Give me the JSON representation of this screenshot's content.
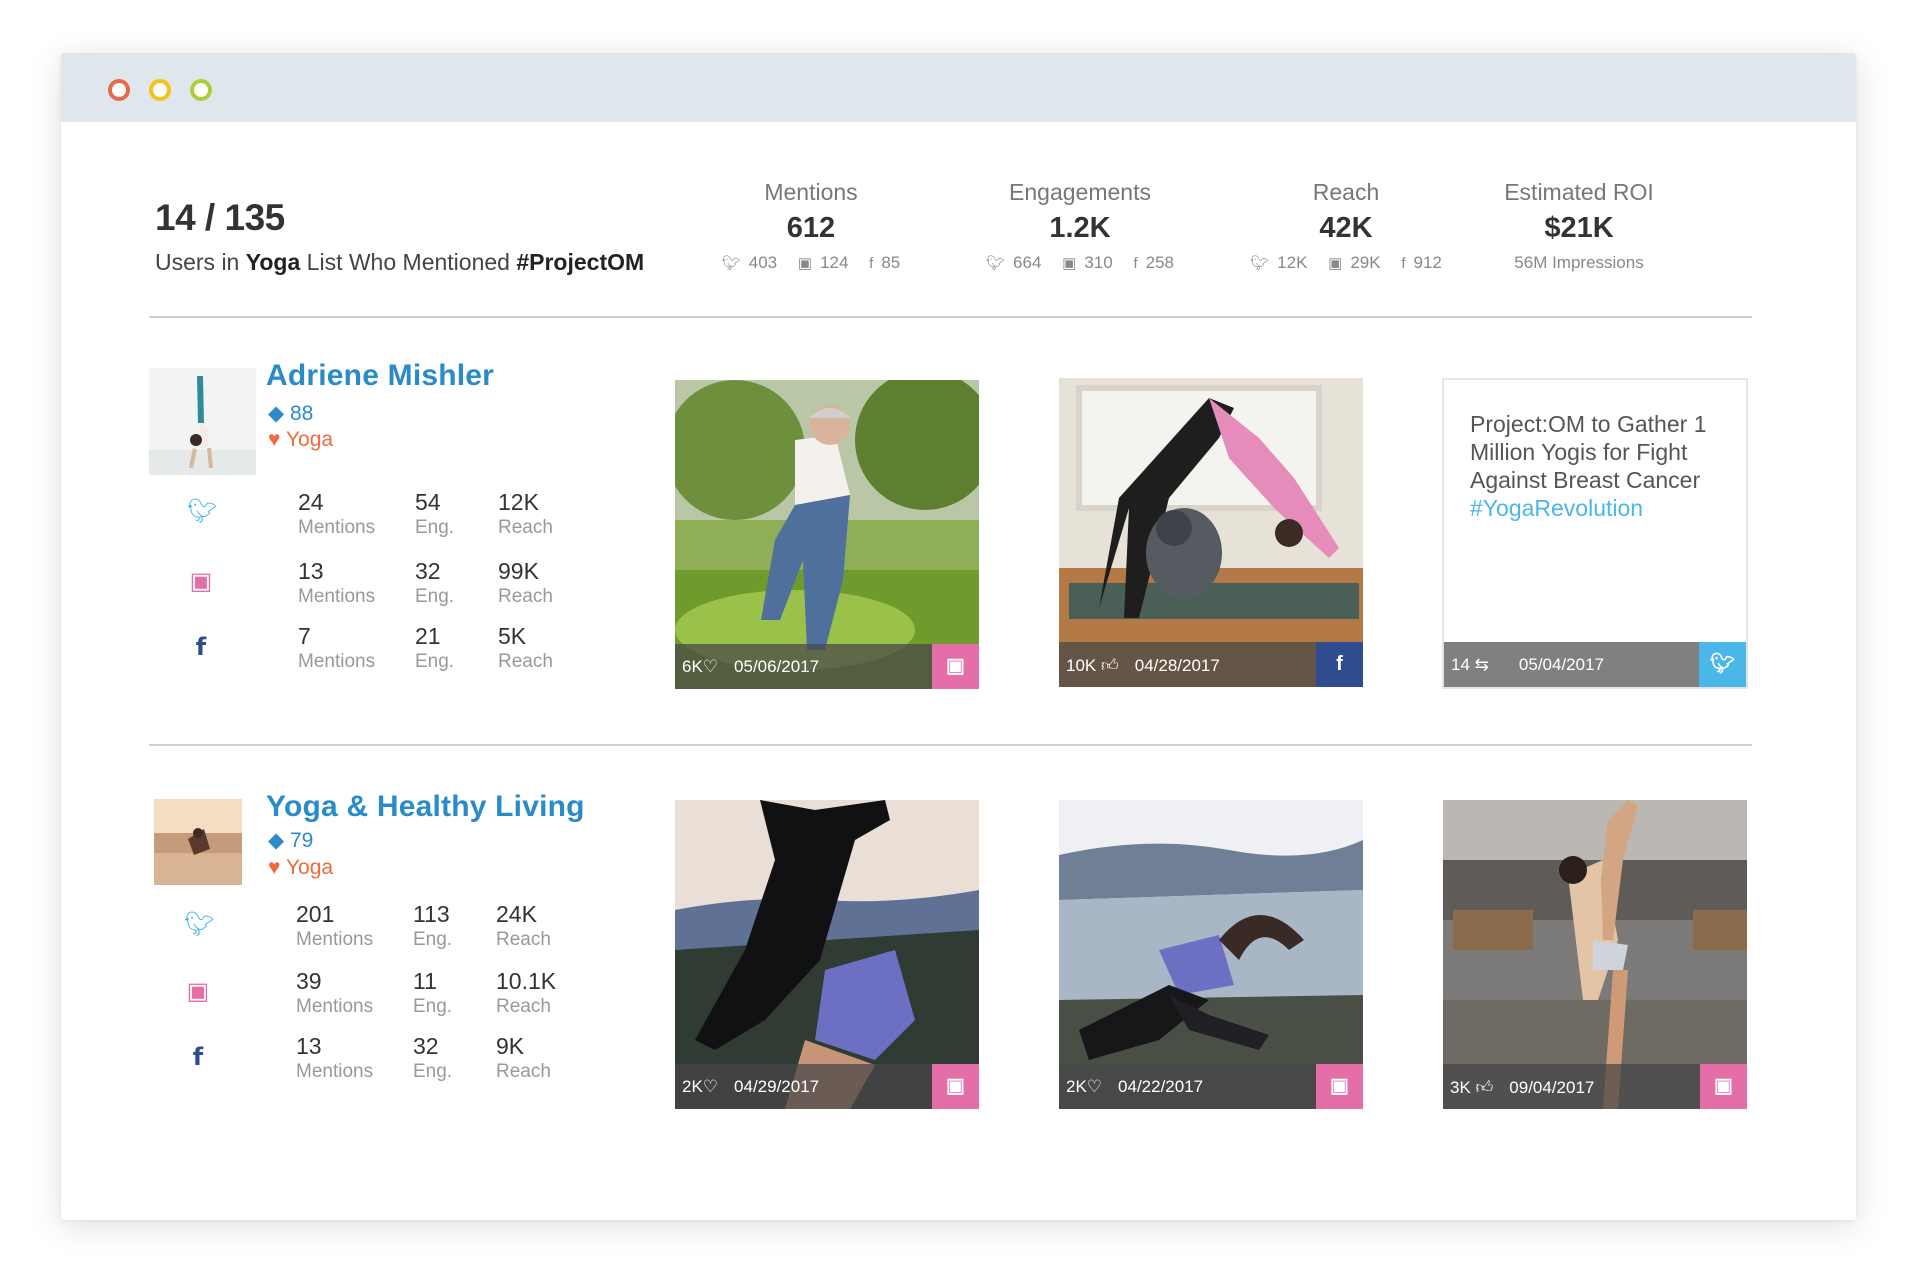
{
  "window": {
    "controls": [
      "close",
      "minimize",
      "maximize"
    ]
  },
  "summary": {
    "count": "14 / 135",
    "text_prefix": "Users in",
    "list_name": "Yoga",
    "text_middle": "List Who Mentioned",
    "hashtag": "#ProjectOM"
  },
  "metrics": [
    {
      "label": "Mentions",
      "value": "612",
      "sub": [
        {
          "icon": "twitter-icon",
          "value": "403"
        },
        {
          "icon": "instagram-icon",
          "value": "124"
        },
        {
          "icon": "facebook-icon",
          "value": "85"
        }
      ]
    },
    {
      "label": "Engagements",
      "value": "1.2K",
      "sub": [
        {
          "icon": "twitter-icon",
          "value": "664"
        },
        {
          "icon": "instagram-icon",
          "value": "310"
        },
        {
          "icon": "facebook-icon",
          "value": "258"
        }
      ]
    },
    {
      "label": "Reach",
      "value": "42K",
      "sub": [
        {
          "icon": "twitter-icon",
          "value": "12K"
        },
        {
          "icon": "instagram-icon",
          "value": "29K"
        },
        {
          "icon": "facebook-icon",
          "value": "912"
        }
      ]
    },
    {
      "label": "Estimated ROI",
      "value": "$21K",
      "impressions": "56M Impressions"
    }
  ],
  "users": [
    {
      "name": "Adriene Mishler",
      "score": "88",
      "list": "Yoga",
      "networks": [
        {
          "network": "twitter",
          "mentions": "24",
          "mentions_label": "Mentions",
          "eng": "54",
          "eng_label": "Eng.",
          "reach": "12K",
          "reach_label": "Reach"
        },
        {
          "network": "instagram",
          "mentions": "13",
          "mentions_label": "Mentions",
          "eng": "32",
          "eng_label": "Eng.",
          "reach": "99K",
          "reach_label": "Reach"
        },
        {
          "network": "facebook",
          "mentions": "7",
          "mentions_label": "Mentions",
          "eng": "21",
          "eng_label": "Eng.",
          "reach": "5K",
          "reach_label": "Reach"
        }
      ],
      "posts": [
        {
          "type": "photo",
          "network": "instagram",
          "count": "6K",
          "date": "05/06/2017"
        },
        {
          "type": "photo",
          "network": "facebook",
          "count": "10K",
          "date": "04/28/2017"
        },
        {
          "type": "text",
          "network": "twitter",
          "count": "14",
          "date": "05/04/2017",
          "text": "Project:OM to Gather 1 Million Yogis for Fight Against Breast Cancer",
          "hashtag": "#YogaRevolution"
        }
      ]
    },
    {
      "name": "Yoga & Healthy Living",
      "score": "79",
      "list": "Yoga",
      "networks": [
        {
          "network": "twitter",
          "mentions": "201",
          "mentions_label": "Mentions",
          "eng": "113",
          "eng_label": "Eng.",
          "reach": "24K",
          "reach_label": "Reach"
        },
        {
          "network": "instagram",
          "mentions": "39",
          "mentions_label": "Mentions",
          "eng": "11",
          "eng_label": "Eng.",
          "reach": "10.1K",
          "reach_label": "Reach"
        },
        {
          "network": "facebook",
          "mentions": "13",
          "mentions_label": "Mentions",
          "eng": "32",
          "eng_label": "Eng.",
          "reach": "9K",
          "reach_label": "Reach"
        }
      ],
      "posts": [
        {
          "type": "photo",
          "network": "instagram",
          "count": "2K",
          "date": "04/29/2017"
        },
        {
          "type": "photo",
          "network": "instagram",
          "count": "2K",
          "date": "04/22/2017"
        },
        {
          "type": "photo",
          "network": "instagram",
          "count": "3K",
          "date": "09/04/2017"
        }
      ]
    }
  ],
  "colors": {
    "accent_blue": "#2a8bc9",
    "list_orange": "#f06a3b",
    "twitter": "#4bb6e8",
    "instagram": "#e46ea8",
    "facebook": "#2f4c8f"
  }
}
